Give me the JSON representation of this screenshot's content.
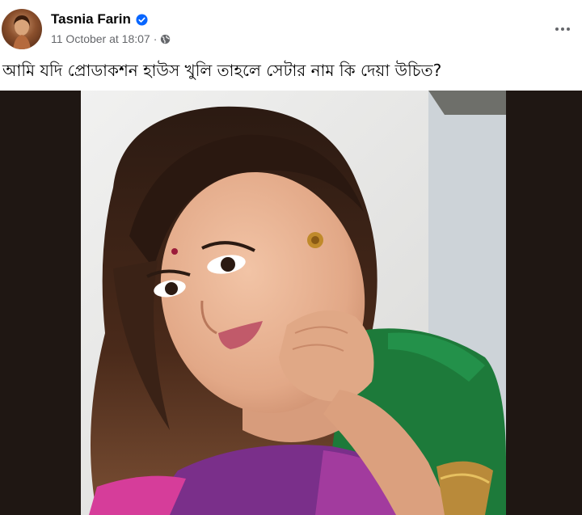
{
  "post": {
    "author_name": "Tasnia Farin",
    "timestamp": "11 October at 18:07",
    "separator": "·",
    "verified_icon": "verified-badge-icon",
    "privacy_icon": "globe-icon",
    "more_icon": "more-options-icon",
    "caption": "আমি যদি প্রোডাকশন হাউস খুলি তাহলে সেটার নাম কি দেয়া উচিত?"
  },
  "colors": {
    "verified_blue": "#0866ff",
    "meta_gray": "#65676b",
    "text": "#050505",
    "media_background": "#1f1713",
    "top_green": "#1d7a3a",
    "sari_purple": "#7a2f8a"
  }
}
